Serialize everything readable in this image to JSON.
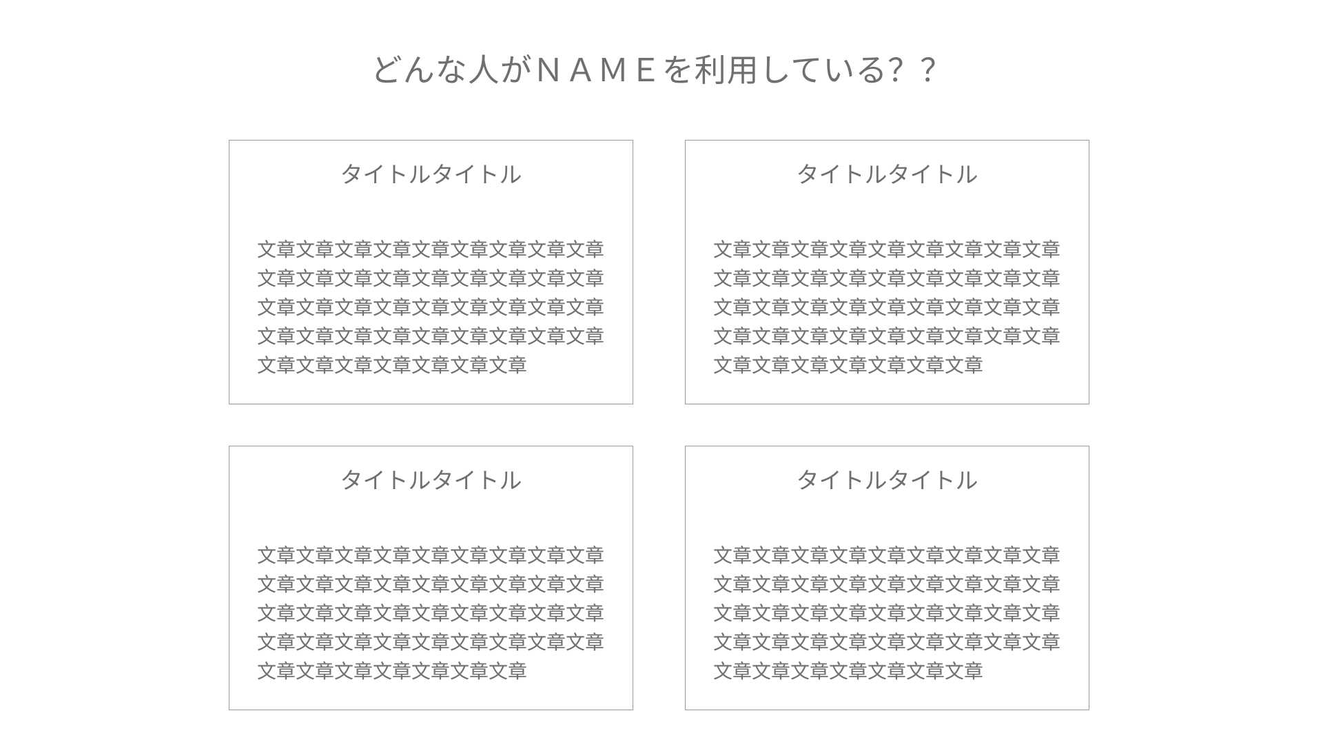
{
  "page": {
    "title": "どんな人がＮＡＭＥを利用している？？"
  },
  "cards": [
    {
      "title": "タイトルタイトル",
      "body": "文章文章文章文章文章文章文章文章文章\n文章文章文章文章文章文章文章文章文章\n文章文章文章文章文章文章文章文章文章\n文章文章文章文章文章文章文章文章文章\n文章文章文章文章文章文章文章"
    },
    {
      "title": "タイトルタイトル",
      "body": "文章文章文章文章文章文章文章文章文章\n文章文章文章文章文章文章文章文章文章\n文章文章文章文章文章文章文章文章文章\n文章文章文章文章文章文章文章文章文章\n文章文章文章文章文章文章文章"
    },
    {
      "title": "タイトルタイトル",
      "body": "文章文章文章文章文章文章文章文章文章\n文章文章文章文章文章文章文章文章文章\n文章文章文章文章文章文章文章文章文章\n文章文章文章文章文章文章文章文章文章\n文章文章文章文章文章文章文章"
    },
    {
      "title": "タイトルタイトル",
      "body": "文章文章文章文章文章文章文章文章文章\n文章文章文章文章文章文章文章文章文章\n文章文章文章文章文章文章文章文章文章\n文章文章文章文章文章文章文章文章文章\n文章文章文章文章文章文章文章"
    }
  ],
  "colors": {
    "text": "#6f6f6f",
    "border": "#9a9a9a",
    "background": "#ffffff"
  }
}
